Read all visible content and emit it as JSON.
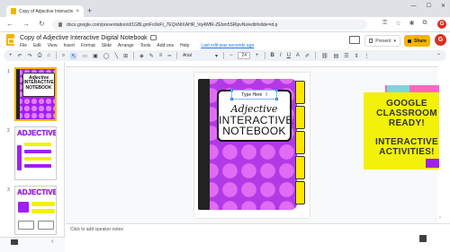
{
  "browser": {
    "tab_title": "Copy of Adjective Interactive D",
    "tab_close": "×",
    "new_tab": "+",
    "url": "docs.google.com/presentation/d/1GBLgmFo9oFt_7EQnNtXAHR_Vq4WfR-ZEbm5SRlpvNs/edit#slide=id.p",
    "avatar_letter": "G"
  },
  "docs": {
    "title": "Copy of Adjective Interactive Digital Notebook",
    "menus": [
      "File",
      "Edit",
      "View",
      "Insert",
      "Format",
      "Slide",
      "Arrange",
      "Tools",
      "Add-ons",
      "Help"
    ],
    "last_edit": "Last edit was seconds ago",
    "present_label": "Present",
    "share_label": "Share",
    "user_letter": "G"
  },
  "toolbar": {
    "font": "Arial",
    "font_size": "24",
    "bold": "B",
    "italic": "I",
    "underline": "U",
    "text_color": "A"
  },
  "filmstrip": {
    "slides": [
      {
        "num": "1",
        "title_lines": [
          "Adjective",
          "INTERACTIVE",
          "NOTEBOOK"
        ]
      },
      {
        "num": "2",
        "heading": "ADJECTIVES"
      },
      {
        "num": "3",
        "heading": "ADJECTIVES"
      }
    ]
  },
  "slide": {
    "type_here": "Type Here",
    "cursor": "I",
    "line1": "Adjective",
    "line2": "INTERACTIVE",
    "line3": "NOTEBOOK"
  },
  "promo": {
    "lines_a": "GOOGLE CLASSROOM READY!",
    "lines_b": "INTERACTIVE ACTIVITIES!"
  },
  "notes": {
    "placeholder": "Click to add speaker notes"
  },
  "colors": {
    "accent_yellow": "#f4b400",
    "notebook_purple": "#b23ae6",
    "promo_yellow": "#f1f10a"
  }
}
